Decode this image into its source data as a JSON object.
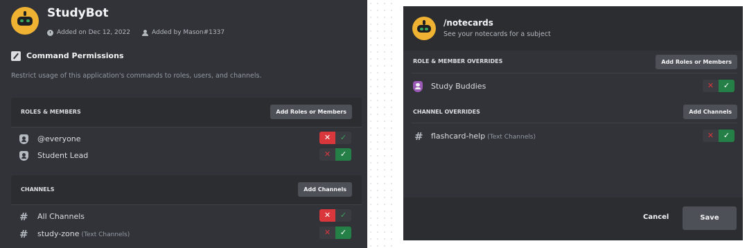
{
  "app_settings": {
    "bot": {
      "name": "StudyBot",
      "added_on": "Added on Dec 12, 2022",
      "added_by": "Added by Mason#1337"
    },
    "command_permissions": {
      "title": "Command Permissions",
      "description": "Restrict usage of this application's commands to roles, users, and channels."
    },
    "roles_section": {
      "header": "ROLES & MEMBERS",
      "button": "Add Roles or Members",
      "items": [
        {
          "icon": "shield-icon",
          "name": "@everyone",
          "state": "denied"
        },
        {
          "icon": "shield-icon",
          "name": "Student Lead",
          "state": "allowed"
        }
      ]
    },
    "channels_section": {
      "header": "CHANNELS",
      "button": "Add Channels",
      "items": [
        {
          "icon": "hashtag-icon",
          "name": "All Channels",
          "sub": "",
          "state": "denied"
        },
        {
          "icon": "hashtag-icon",
          "name": "study-zone",
          "sub": "(Text Channels)",
          "state": "allowed"
        }
      ]
    }
  },
  "command_modal": {
    "command": "/notecards",
    "description": "See your notecards for a subject",
    "role_overrides": {
      "header": "ROLE & MEMBER OVERRIDES",
      "button": "Add Roles or Members",
      "items": [
        {
          "icon": "shield-icon",
          "name": "Study Buddies",
          "state": "allowed"
        }
      ]
    },
    "channel_overrides": {
      "header": "CHANNEL OVERRIDES",
      "button": "Add Channels",
      "items": [
        {
          "icon": "hashtag-icon",
          "name": "flashcard-help",
          "sub": "(Text Channels)",
          "state": "allowed"
        }
      ]
    },
    "cancel_label": "Cancel",
    "save_label": "Save"
  },
  "toggle_glyphs": {
    "deny": "✕",
    "allow": "✓"
  },
  "colors": {
    "background": "#313338",
    "section": "#2b2d31",
    "deny": "#da373c",
    "allow": "#248046",
    "button": "#4e5058",
    "bot_avatar": "#f0b232",
    "role_badge": "#9b59b6"
  }
}
